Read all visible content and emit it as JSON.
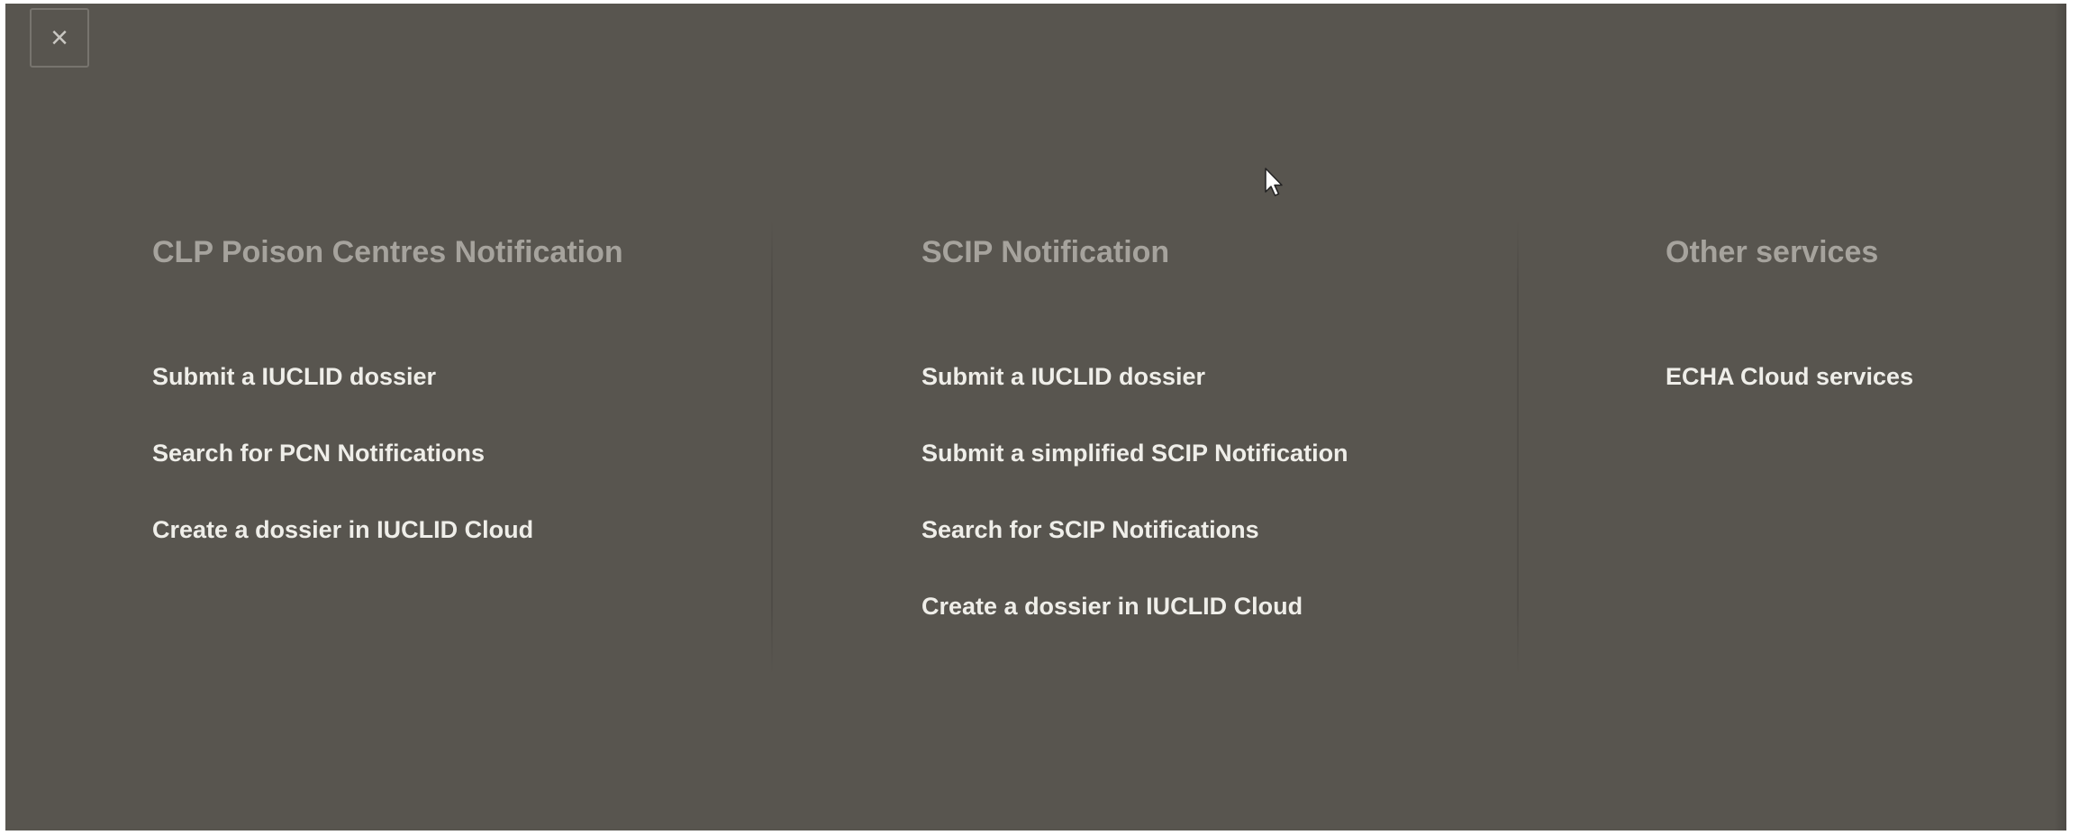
{
  "close_button": {
    "label": "×"
  },
  "columns": [
    {
      "title": "CLP Poison Centres Notification",
      "links": [
        "Submit a IUCLID dossier",
        "Search for PCN Notifications",
        "Create a dossier in IUCLID Cloud"
      ]
    },
    {
      "title": "SCIP Notification",
      "links": [
        "Submit a IUCLID dossier",
        "Submit a simplified SCIP Notification",
        "Search for SCIP Notifications",
        "Create a dossier in IUCLID Cloud"
      ]
    },
    {
      "title": "Other services",
      "links": [
        "ECHA Cloud services"
      ]
    }
  ],
  "colors": {
    "overlay_background": "#58554f",
    "title_text": "#a6a39d",
    "link_text": "#efeee9"
  },
  "icons": {
    "close": "close-icon",
    "cursor": "mouse-pointer-icon"
  }
}
